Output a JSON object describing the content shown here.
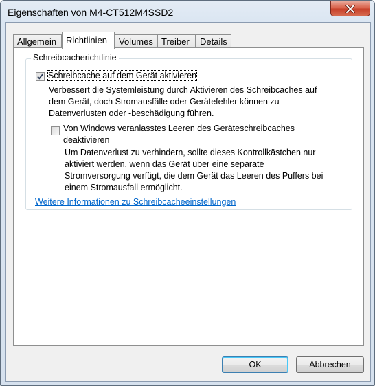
{
  "window": {
    "title": "Eigenschaften von M4-CT512M4SSD2"
  },
  "tabs": [
    {
      "label": "Allgemein"
    },
    {
      "label": "Richtlinien"
    },
    {
      "label": "Volumes"
    },
    {
      "label": "Treiber"
    },
    {
      "label": "Details"
    }
  ],
  "active_tab": "Richtlinien",
  "group": {
    "legend": "Schreibcacherichtlinie",
    "option1": {
      "label": "Schreibcache auf dem Gerät aktivieren",
      "checked": true,
      "desc1": "Verbessert die Systemleistung durch Aktivieren des Schreibcaches auf",
      "desc2": "dem Gerät, doch Stromausfälle oder Gerätefehler können zu",
      "desc3": "Datenverlusten oder -beschädigung führen."
    },
    "option2": {
      "label1": "Von Windows veranlasstes Leeren des Geräteschreibcaches",
      "label2": "deaktivieren",
      "checked": false,
      "desc1": "Um Datenverlust zu verhindern, sollte dieses Kontrollkästchen nur",
      "desc2": "aktiviert werden, wenn das Gerät über eine separate",
      "desc3": "Stromversorgung verfügt, die dem Gerät das Leeren des Puffers bei",
      "desc4": "einem Stromausfall ermöglicht."
    },
    "link": "Weitere Informationen zu Schreibcacheeinstellungen"
  },
  "buttons": {
    "ok": "OK",
    "cancel": "Abbrechen"
  }
}
